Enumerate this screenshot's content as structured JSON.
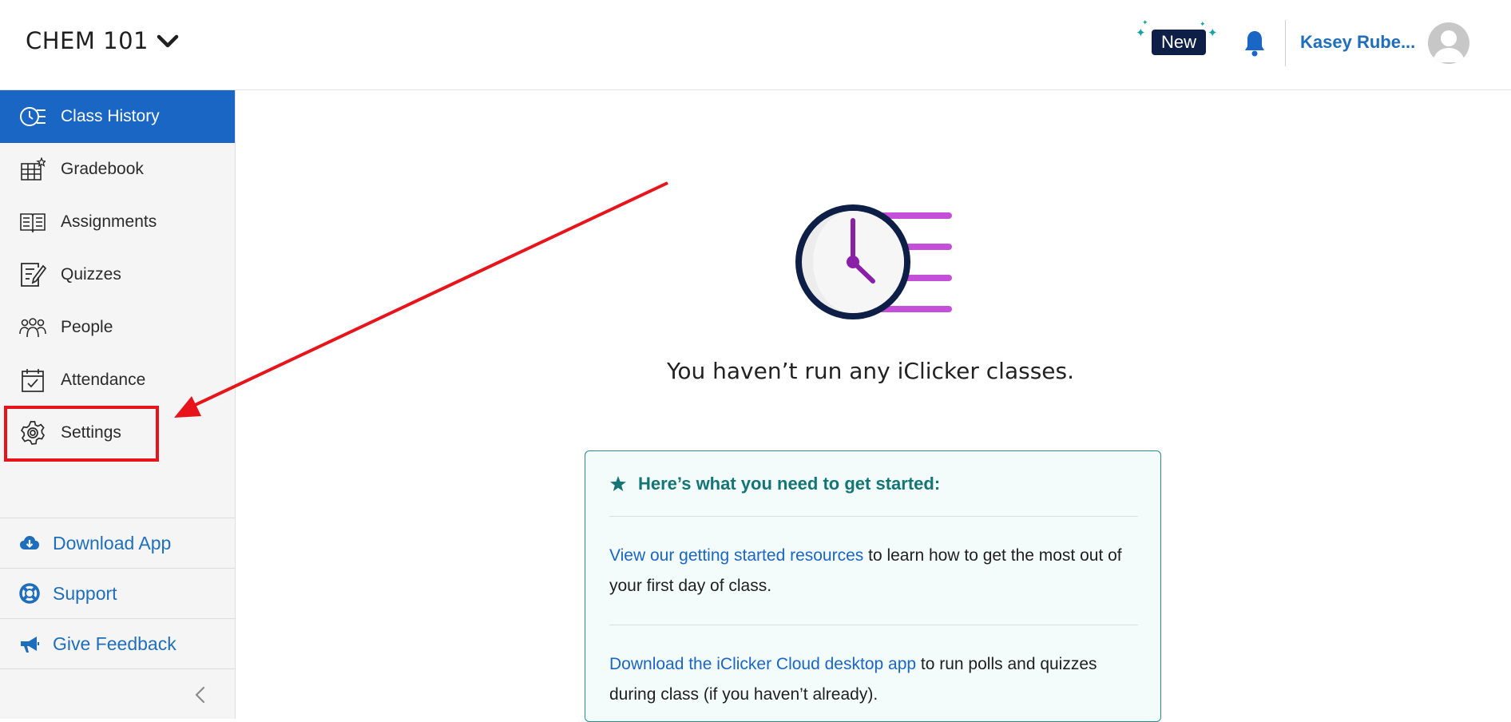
{
  "header": {
    "course_name": "CHEM 101",
    "new_badge": "New",
    "user_name": "Kasey Rube..."
  },
  "sidebar": {
    "items": [
      {
        "label": "Class History",
        "icon": "class-history-icon",
        "active": true
      },
      {
        "label": "Gradebook",
        "icon": "gradebook-icon"
      },
      {
        "label": "Assignments",
        "icon": "assignments-icon"
      },
      {
        "label": "Quizzes",
        "icon": "quizzes-icon"
      },
      {
        "label": "People",
        "icon": "people-icon"
      },
      {
        "label": "Attendance",
        "icon": "attendance-icon"
      },
      {
        "label": "Settings",
        "icon": "gear-icon"
      }
    ],
    "footer": [
      {
        "label": "Download App",
        "icon": "cloud-download-icon"
      },
      {
        "label": "Support",
        "icon": "lifebuoy-icon"
      },
      {
        "label": "Give Feedback",
        "icon": "megaphone-icon"
      }
    ]
  },
  "main": {
    "empty_title": "You haven’t run any iClicker classes.",
    "card": {
      "title": "Here’s what you need to get started:",
      "para1_link": "View our getting started resources",
      "para1_text": " to learn how to get the most out of your first day of class.",
      "para2_link": "Download the iClicker Cloud desktop app",
      "para2_text": " to run polls and quizzes during class (if you haven’t already)."
    }
  },
  "colors": {
    "active_nav": "#1a66c4",
    "link": "#1f6ebc",
    "annotation": "#e8141b",
    "card_accent": "#137575"
  }
}
